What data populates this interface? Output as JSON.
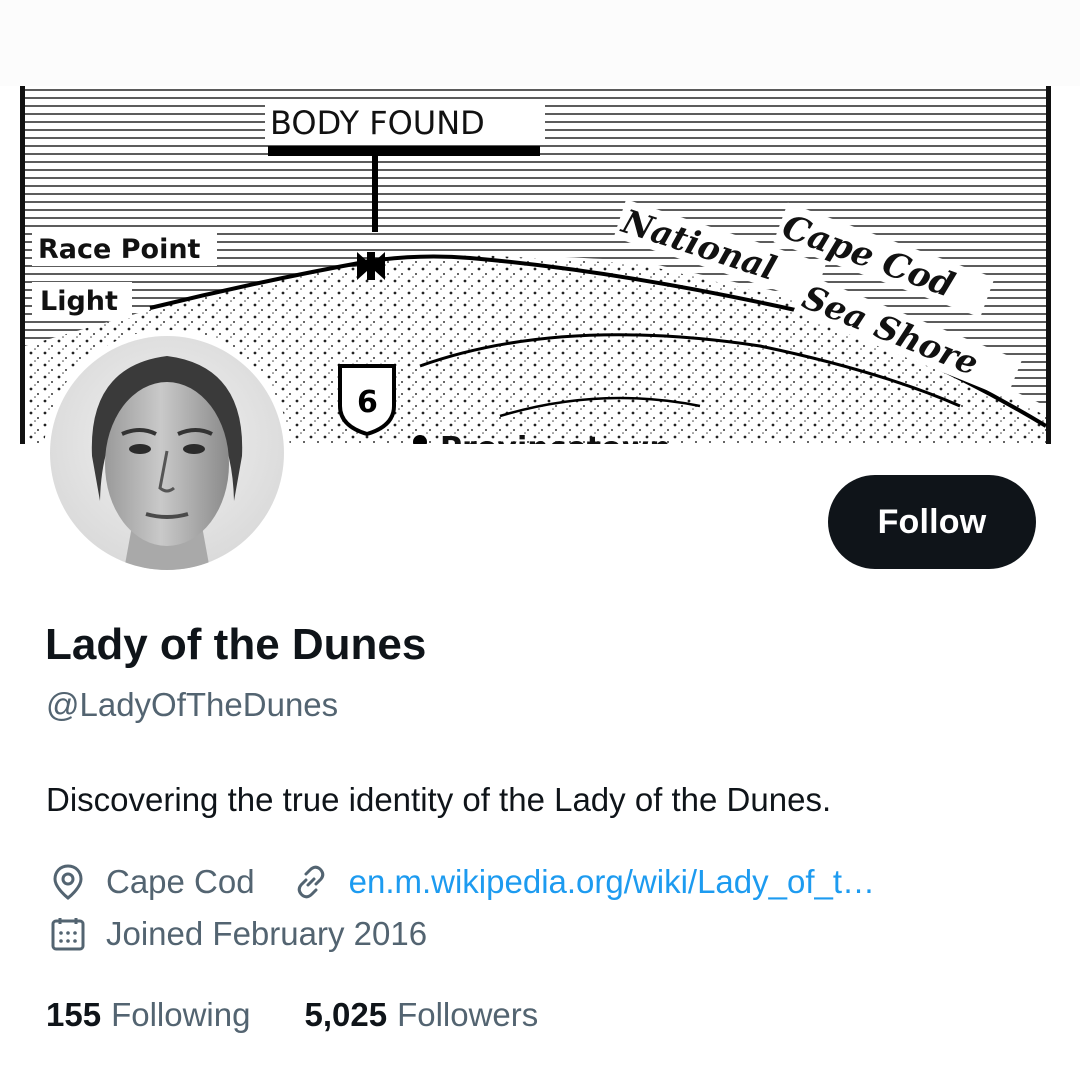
{
  "banner": {
    "headline": "BODY FOUND",
    "label_race_point": "Race Point",
    "label_light": "Light",
    "label_cape_cod": "Cape Cod",
    "label_national_sea_shore_1": "National",
    "label_national_sea_shore_2": "Sea Shore",
    "route_number": "6",
    "partial_town": "Provincetown",
    "marker_icon": "cross-marker-icon"
  },
  "profile": {
    "display_name": "Lady of the Dunes",
    "handle": "@LadyOfTheDunes",
    "bio": "Discovering the true identity of the Lady of the Dunes.",
    "location": "Cape Cod",
    "website": "en.m.wikipedia.org/wiki/Lady_of_t…",
    "joined": "Joined February 2016",
    "follow_label": "Follow"
  },
  "stats": {
    "following_count": "155",
    "following_label": "Following",
    "followers_count": "5,025",
    "followers_label": "Followers"
  },
  "icons": {
    "location": "location-pin-icon",
    "link": "link-icon",
    "calendar": "calendar-icon"
  },
  "colors": {
    "text_primary": "#0f1419",
    "text_secondary": "#536471",
    "link": "#1d9bf0",
    "button_bg": "#0f1419",
    "button_text": "#ffffff"
  }
}
